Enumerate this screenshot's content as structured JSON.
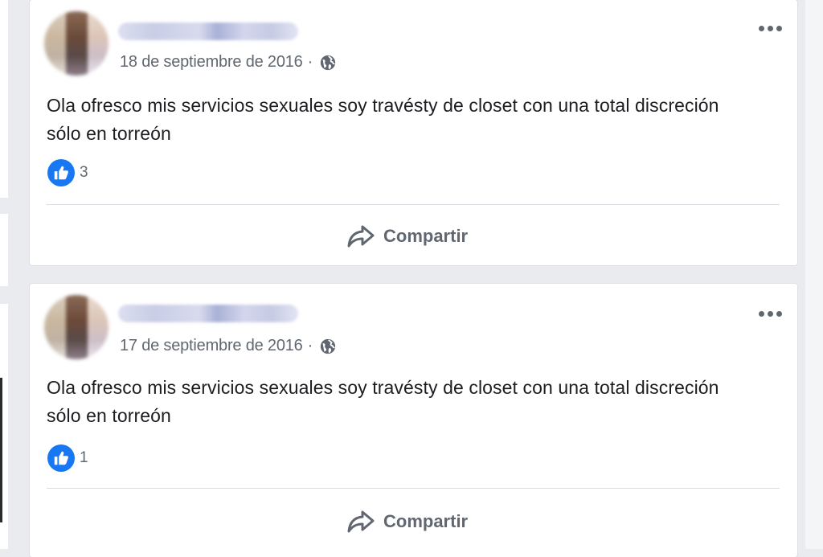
{
  "posts": [
    {
      "date": "18 de septiembre de 2016",
      "separator": "·",
      "privacy_icon": "globe-icon",
      "text": "Ola ofresco mis servicios sexuales soy travésty de closet con una total discreción sólo en torreón",
      "reaction_icon": "like-icon",
      "reaction_count": "3",
      "share_label": "Compartir",
      "more_icon": "more-options-icon"
    },
    {
      "date": "17 de septiembre de 2016",
      "separator": "·",
      "privacy_icon": "globe-icon",
      "text": "Ola ofresco mis servicios sexuales soy travésty de closet con una total discreción sólo en torreón",
      "reaction_icon": "like-icon",
      "reaction_count": "1",
      "share_label": "Compartir",
      "more_icon": "more-options-icon"
    }
  ],
  "colors": {
    "background": "#e9ebee",
    "card": "#ffffff",
    "text": "#1c1e21",
    "secondary_text": "#606770",
    "like_blue": "#1877f2"
  }
}
